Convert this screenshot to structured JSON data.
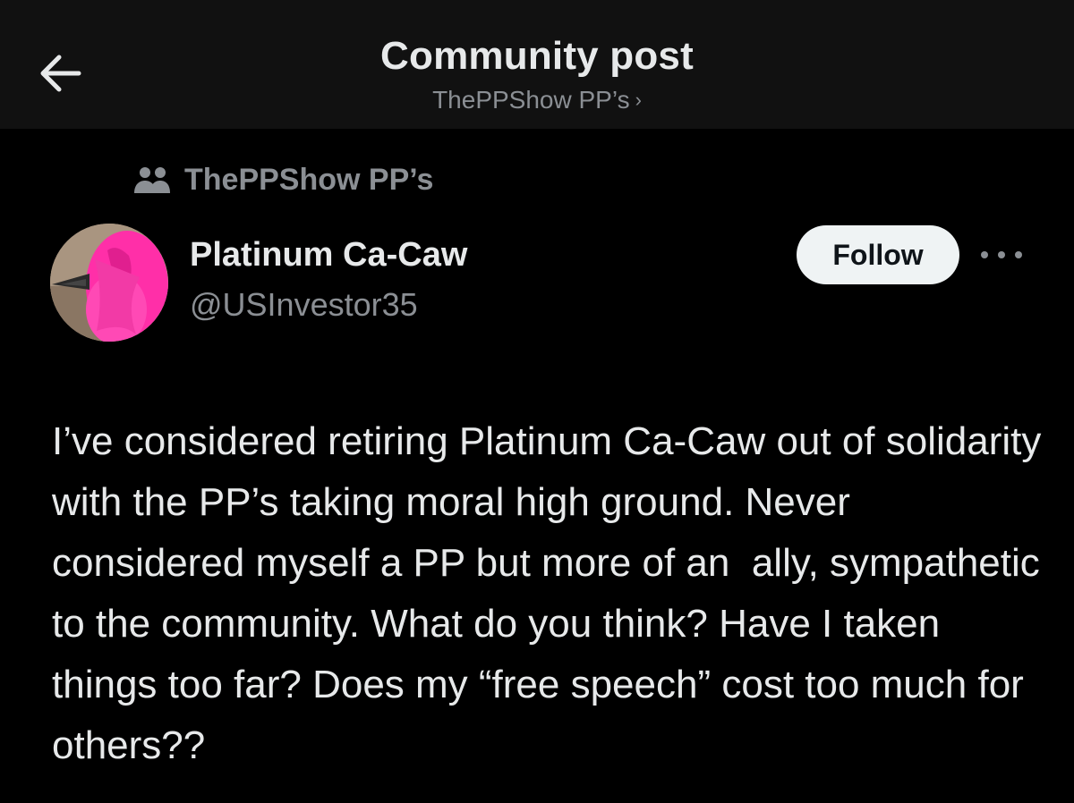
{
  "header": {
    "title": "Community post",
    "subtitle": "ThePPShow PP’s",
    "subtitle_chevron": "›",
    "back_icon": "arrow-left-icon"
  },
  "community": {
    "icon": "community-people-icon",
    "name": "ThePPShow PP’s"
  },
  "author": {
    "display_name": "Platinum Ca-Caw",
    "handle": "@USInvestor35",
    "avatar_description_icon": "avatar-image"
  },
  "actions": {
    "follow_label": "Follow",
    "more_icon": "more-horizontal-icon"
  },
  "post": {
    "text": "I’ve considered retiring Platinum Ca-Caw out of solidarity with the PP’s taking moral high ground. Never considered myself a PP but more of an  ally, sympathetic to the community. What do you think? Have I taken things too far? Does my “free speech” cost too much for others??"
  },
  "colors": {
    "background": "#000000",
    "header_bg": "#111111",
    "text_primary": "#e7e9ea",
    "text_secondary": "#8b8f94",
    "follow_bg": "#eff3f4"
  }
}
